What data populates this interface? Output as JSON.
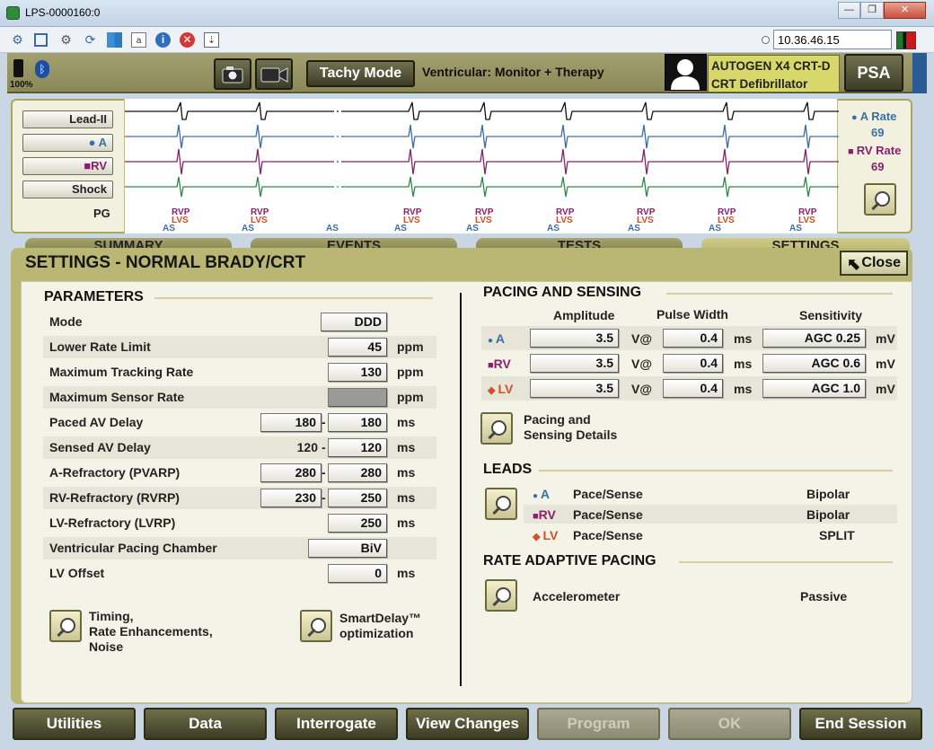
{
  "window": {
    "title": "LPS-0000160:0",
    "ip_address": "10.36.46.15",
    "controls": [
      "—",
      "❐",
      "✕"
    ]
  },
  "toolbar": {
    "icons": [
      "gears-icon",
      "fullscreen-icon",
      "settings-icon",
      "refresh-icon",
      "windows-icon",
      "keyboard-icon",
      "info-icon",
      "stop-icon",
      "transfer-icon"
    ]
  },
  "header": {
    "battery": "100%",
    "tachy_mode": "Tachy Mode",
    "mode_label": "Ventricular: Monitor + Therapy",
    "device_line1": "AUTOGEN X4 CRT-D",
    "device_line2": "CRT Defibrillator",
    "psa": "PSA"
  },
  "ecg": {
    "leads": [
      "Lead-II",
      "A",
      "RV",
      "Shock"
    ],
    "pg": "PG",
    "a_rate_label": "A Rate",
    "a_rate": "69",
    "rv_rate_label": "RV Rate",
    "rv_rate": "69",
    "markers": [
      {
        "top": "RVP",
        "bot": "LVS",
        "as": "AS"
      },
      {
        "top": "RVP",
        "bot": "LVS",
        "as": "AS"
      },
      {
        "top": "",
        "bot": "",
        "as": "AS"
      },
      {
        "top": "RVP",
        "bot": "LVS",
        "as": "AS"
      },
      {
        "top": "RVP",
        "bot": "LVS",
        "as": "AS"
      },
      {
        "top": "RVP",
        "bot": "LVS",
        "as": "AS"
      },
      {
        "top": "RVP",
        "bot": "LVS",
        "as": "AS"
      },
      {
        "top": "RVP",
        "bot": "LVS",
        "as": "AS"
      },
      {
        "top": "RVP",
        "bot": "LVS",
        "as": "AS"
      }
    ]
  },
  "tabs": [
    "SUMMARY",
    "EVENTS",
    "TESTS",
    "SETTINGS"
  ],
  "settings": {
    "title": "SETTINGS - NORMAL BRADY/CRT",
    "close": "Close"
  },
  "parameters": {
    "title": "PARAMETERS",
    "rows": {
      "mode": {
        "label": "Mode",
        "value": "DDD"
      },
      "lrl": {
        "label": "Lower Rate Limit",
        "value": "45",
        "unit": "ppm"
      },
      "mtr": {
        "label": "Maximum Tracking Rate",
        "value": "130",
        "unit": "ppm"
      },
      "msr": {
        "label": "Maximum Sensor Rate",
        "value": "",
        "unit": "ppm"
      },
      "pav": {
        "label": "Paced AV Delay",
        "v1": "180",
        "v2": "180",
        "unit": "ms"
      },
      "sav": {
        "label": "Sensed AV Delay",
        "v1": "120",
        "v2": "120",
        "unit": "ms"
      },
      "arp": {
        "label": "A-Refractory (PVARP)",
        "v1": "280",
        "v2": "280",
        "unit": "ms"
      },
      "rvrp": {
        "label": "RV-Refractory (RVRP)",
        "v1": "230",
        "v2": "250",
        "unit": "ms"
      },
      "lvrp": {
        "label": "LV-Refractory (LVRP)",
        "value": "250",
        "unit": "ms"
      },
      "vpc": {
        "label": "Ventricular Pacing Chamber",
        "value": "BiV"
      },
      "lvo": {
        "label": "LV Offset",
        "value": "0",
        "unit": "ms"
      }
    },
    "link1": [
      "Timing,",
      "Rate Enhancements,",
      "Noise"
    ],
    "link2": [
      "SmartDelay™",
      "optimization"
    ]
  },
  "pacing": {
    "title": "PACING AND SENSING",
    "hdr_amp": "Amplitude",
    "hdr_pw": "Pulse Width",
    "hdr_sens": "Sensitivity",
    "rows": [
      {
        "chan": "A",
        "amp": "3.5",
        "amp_unit": "V@",
        "pw": "0.4",
        "pw_unit": "ms",
        "sens": "AGC 0.25",
        "sens_unit": "mV"
      },
      {
        "chan": "RV",
        "amp": "3.5",
        "amp_unit": "V@",
        "pw": "0.4",
        "pw_unit": "ms",
        "sens": "AGC 0.6",
        "sens_unit": "mV"
      },
      {
        "chan": "LV",
        "amp": "3.5",
        "amp_unit": "V@",
        "pw": "0.4",
        "pw_unit": "ms",
        "sens": "AGC 1.0",
        "sens_unit": "mV"
      }
    ],
    "details": [
      "Pacing and",
      "Sensing Details"
    ]
  },
  "leads": {
    "title": "LEADS",
    "rows": [
      {
        "chan": "A",
        "type": "Pace/Sense",
        "config": "Bipolar"
      },
      {
        "chan": "RV",
        "type": "Pace/Sense",
        "config": "Bipolar"
      },
      {
        "chan": "LV",
        "type": "Pace/Sense",
        "config": "SPLIT"
      }
    ]
  },
  "rate_adaptive": {
    "title": "RATE ADAPTIVE PACING",
    "sensor": "Accelerometer",
    "value": "Passive"
  },
  "bottom": [
    "Utilities",
    "Data",
    "Interrogate",
    "View Changes",
    "Program",
    "OK",
    "End Session"
  ],
  "colors": {
    "a": "#3a6ea8",
    "rv": "#8a1f6b",
    "lv": "#d0502a",
    "olive": "#bab673"
  }
}
